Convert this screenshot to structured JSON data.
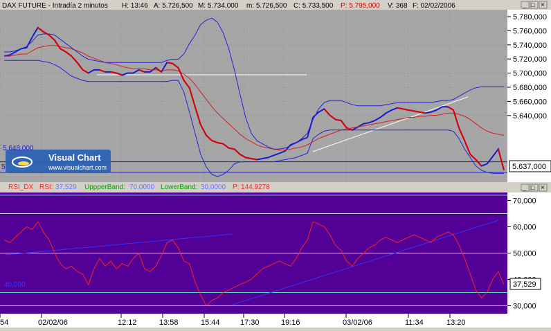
{
  "price_panel": {
    "header": {
      "instrument": "DAX FUTURE - Intradía 2 minutos",
      "high": "H: 13:46",
      "a": "A: 5.726,500",
      "m": "M: 5.734,000",
      "low": "m: 5.726,500",
      "close": "C: 5.733,500",
      "p": "P: 5.795,000",
      "volume": "V: 368",
      "date": "F: 02/02/2006"
    },
    "watermark": {
      "title": "Visual Chart",
      "url": "www.visualchart.com"
    },
    "level_label": "5.648,000",
    "level_label_2": "5",
    "last_value": "5.637,000",
    "colors": {
      "background": "#a6a6a6",
      "price": "#1a1acc",
      "price_down": "#e00000",
      "bands": "#2323d8",
      "ma": "#d81e1e"
    }
  },
  "rsi_panel": {
    "legend": {
      "rsi_name": "RSI_DX",
      "rsi_label": "RSI:",
      "rsi_value": "37,529",
      "upper_label": "UppperBand:",
      "upper_value": "70,0000",
      "lower_label": "LowerBand:",
      "lower_value": "30,0000",
      "p_label": "P:",
      "p_value": "144,9278"
    },
    "left_value": "40,000",
    "last_value": "37,529",
    "colors": {
      "background": "#520095",
      "rsi": "#ff2020",
      "bands": "#5fe0c0",
      "mid": "#f0e070",
      "trend": "#3535ff"
    }
  },
  "window_buttons": [
    "_",
    "□",
    "×"
  ],
  "chart_data": [
    {
      "type": "line",
      "title": "DAX FUTURE - Intradía 2 minutos",
      "x_tick_labels": [
        "54",
        "02/02/06",
        "12:12",
        "13:58",
        "15:44",
        "17:30",
        "19:16",
        "03/02/06",
        "11:34",
        "13:20"
      ],
      "y_tick_labels": [
        "5.780,000",
        "5.760,000",
        "5.740,000",
        "5.720,000",
        "5.700,000",
        "5.680,000",
        "5.660,000",
        "5.640,000"
      ],
      "ylim": [
        5632,
        5790
      ],
      "horizontal_lines": [
        5648,
        5638,
        5724
      ],
      "series": [
        {
          "name": "price",
          "values": [
            5748,
            5749,
            5752,
            5755,
            5756,
            5766,
            5775,
            5771,
            5768,
            5763,
            5755,
            5752,
            5748,
            5742,
            5735,
            5732,
            5735,
            5735,
            5733,
            5733,
            5732,
            5730,
            5732,
            5732,
            5735,
            5733,
            5733,
            5737,
            5733,
            5742,
            5741,
            5737,
            5725,
            5718,
            5700,
            5683,
            5673,
            5668,
            5666,
            5665,
            5661,
            5660,
            5655,
            5652,
            5651,
            5650,
            5651,
            5652,
            5654,
            5656,
            5658,
            5664,
            5666,
            5669,
            5671,
            5690,
            5695,
            5698,
            5692,
            5688,
            5687,
            5680,
            5678,
            5681,
            5684,
            5685,
            5687,
            5690,
            5694,
            5697,
            5699,
            5698,
            5697,
            5696,
            5695,
            5694,
            5695,
            5697,
            5700,
            5700,
            5697,
            5680,
            5668,
            5655,
            5650,
            5644,
            5646,
            5653,
            5660,
            5640
          ]
        },
        {
          "values": [
            5748,
            5748,
            5749,
            5750,
            5750,
            5753,
            5756,
            5757,
            5758,
            5758,
            5757,
            5756,
            5755,
            5753,
            5751,
            5748,
            5746,
            5744,
            5742,
            5741,
            5740,
            5738,
            5737,
            5736,
            5736,
            5736,
            5735,
            5735,
            5734,
            5735,
            5735,
            5734,
            5731,
            5727,
            5721,
            5714,
            5707,
            5700,
            5694,
            5689,
            5684,
            5679,
            5674,
            5670,
            5667,
            5664,
            5662,
            5661,
            5660,
            5659,
            5659,
            5660,
            5661,
            5662,
            5664,
            5667,
            5670,
            5672,
            5674,
            5676,
            5678,
            5679,
            5680,
            5681,
            5682,
            5683,
            5684,
            5685,
            5686,
            5687,
            5688,
            5689,
            5690,
            5690,
            5691,
            5691,
            5692,
            5692,
            5693,
            5694,
            5694,
            5693,
            5691,
            5688,
            5684,
            5680,
            5677,
            5675,
            5674,
            5673
          ]
        },
        {
          "values": [
            5752,
            5752,
            5753,
            5755,
            5757,
            5762,
            5768,
            5769,
            5769,
            5768,
            5764,
            5760,
            5756,
            5752,
            5748,
            5745,
            5744,
            5743,
            5742,
            5742,
            5742,
            5742,
            5742,
            5742,
            5742,
            5742,
            5742,
            5742,
            5742,
            5744,
            5745,
            5745,
            5750,
            5760,
            5768,
            5778,
            5782,
            5784,
            5780,
            5770,
            5755,
            5735,
            5712,
            5690,
            5675,
            5668,
            5665,
            5662,
            5660,
            5660,
            5661,
            5663,
            5666,
            5670,
            5675,
            5688,
            5698,
            5704,
            5706,
            5706,
            5706,
            5704,
            5702,
            5701,
            5701,
            5701,
            5701,
            5701,
            5702,
            5703,
            5704,
            5704,
            5704,
            5704,
            5704,
            5704,
            5704,
            5705,
            5706,
            5706,
            5707,
            5710,
            5713,
            5716,
            5718,
            5719,
            5719,
            5719,
            5719,
            5719
          ]
        },
        {
          "values": [
            5744,
            5744,
            5744,
            5744,
            5744,
            5744,
            5744,
            5743,
            5742,
            5740,
            5737,
            5733,
            5729,
            5727,
            5725,
            5724,
            5724,
            5724,
            5724,
            5724,
            5724,
            5724,
            5724,
            5724,
            5724,
            5724,
            5724,
            5724,
            5724,
            5724,
            5725,
            5725,
            5714,
            5695,
            5675,
            5655,
            5643,
            5636,
            5634,
            5636,
            5640,
            5646,
            5648,
            5648,
            5648,
            5648,
            5648,
            5648,
            5648,
            5649,
            5650,
            5651,
            5652,
            5654,
            5656,
            5670,
            5674,
            5677,
            5678,
            5678,
            5678,
            5678,
            5678,
            5678,
            5678,
            5678,
            5678,
            5678,
            5678,
            5678,
            5678,
            5678,
            5678,
            5678,
            5678,
            5678,
            5678,
            5678,
            5678,
            5678,
            5677,
            5670,
            5660,
            5652,
            5644,
            5640,
            5638,
            5637,
            5637,
            5637
          ]
        }
      ]
    },
    {
      "type": "line",
      "title": "RSI_DX",
      "y_tick_labels": [
        "70,000",
        "60,000",
        "50,000",
        "40,000",
        "30,000"
      ],
      "ylim": [
        27.5,
        72.5
      ],
      "bands": {
        "upper": 70,
        "lower": 30
      },
      "horizontal_lines": [
        72,
        65,
        50,
        35,
        30
      ],
      "series": [
        {
          "name": "RSI",
          "values": [
            55,
            54,
            56,
            58,
            60,
            59,
            62,
            58,
            55,
            50,
            46,
            44,
            45,
            43,
            42,
            38,
            44,
            48,
            45,
            47,
            44,
            46,
            45,
            48,
            50,
            44,
            43,
            45,
            49,
            54,
            55,
            52,
            47,
            46,
            39,
            34,
            30,
            32,
            33,
            35,
            36,
            37,
            38,
            39,
            40,
            42,
            44,
            45,
            46,
            47,
            46,
            45,
            48,
            52,
            55,
            62,
            61,
            60,
            57,
            53,
            51,
            47,
            45,
            48,
            50,
            52,
            53,
            55,
            56,
            55,
            54,
            55,
            56,
            57,
            56,
            55,
            54,
            56,
            57,
            58,
            57,
            53,
            48,
            42,
            36,
            33,
            35,
            40,
            43,
            38
          ]
        }
      ]
    }
  ]
}
